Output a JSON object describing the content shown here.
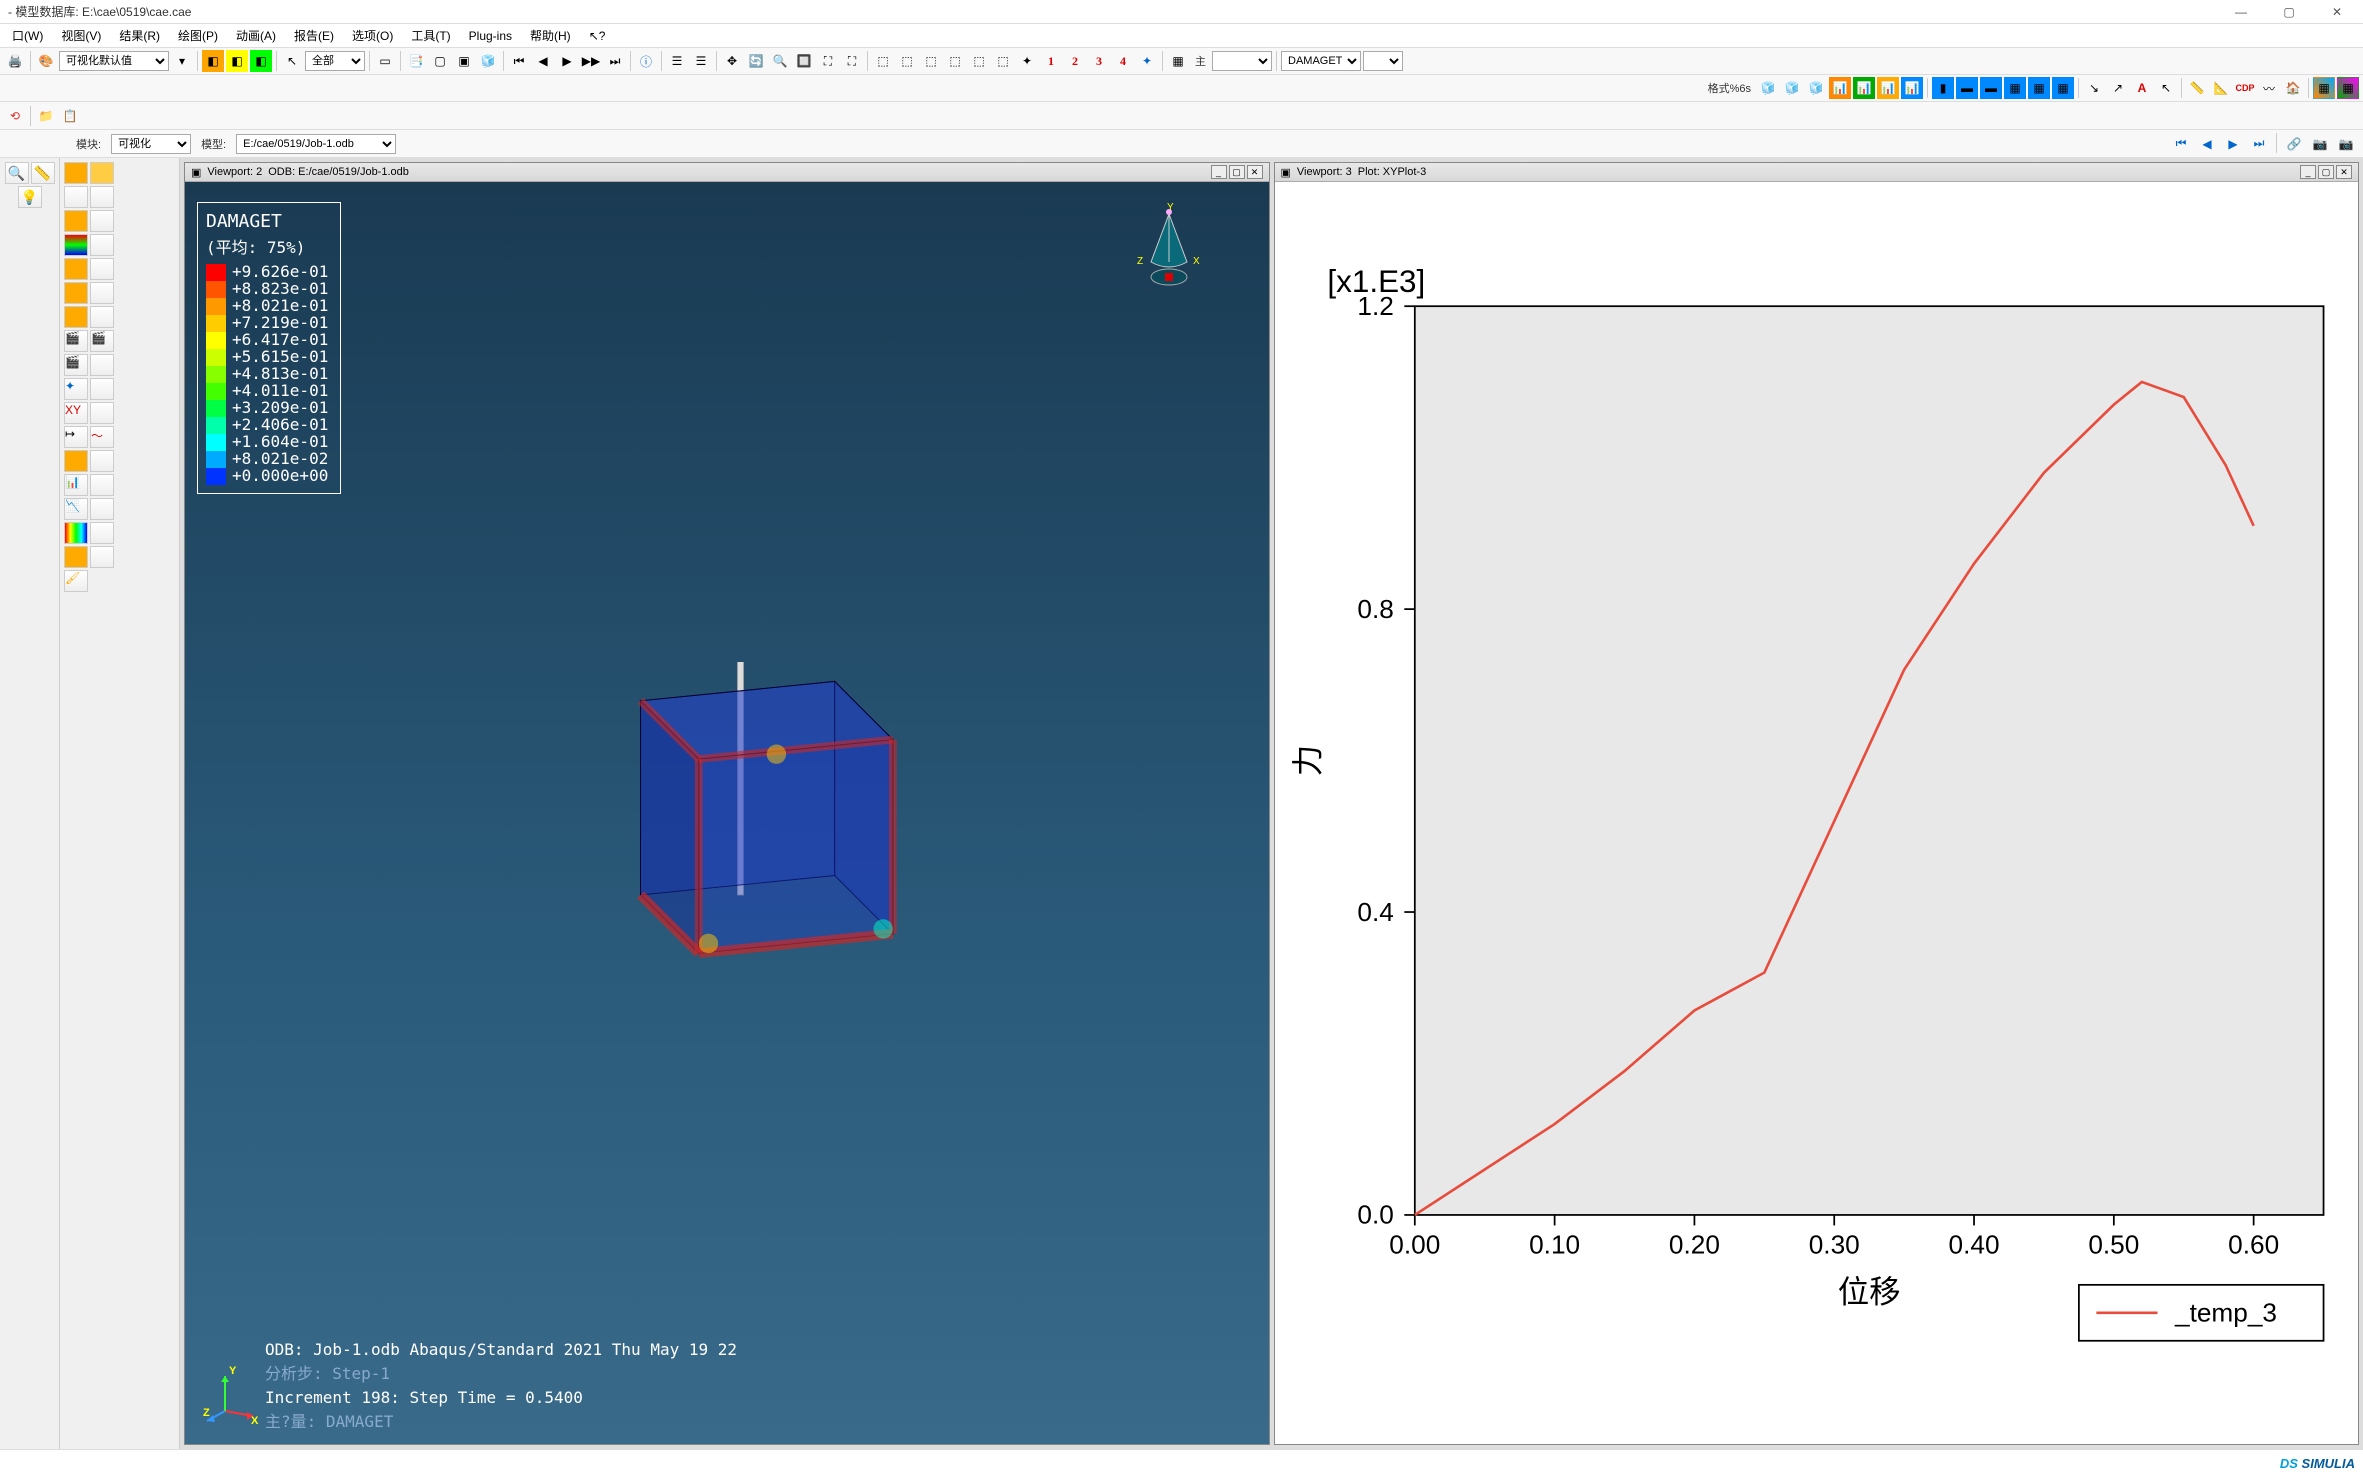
{
  "app": {
    "title_prefix": "- 模型数据库:",
    "db_path": "E:\\cae\\0519\\cae.cae"
  },
  "win_controls": {
    "min": "—",
    "max": "▢",
    "close": "✕"
  },
  "menu": {
    "items": [
      "口(W)",
      "视图(V)",
      "结果(R)",
      "绘图(P)",
      "动画(A)",
      "报告(E)",
      "选项(O)",
      "工具(T)",
      "Plug-ins",
      "帮助(H)",
      "↖?"
    ]
  },
  "toolbar1": {
    "vis_default": "可视化默认值",
    "all": "全部",
    "damaget": "DAMAGET",
    "main": "主"
  },
  "toolbar2": {
    "grid_label": "格式%6s"
  },
  "context": {
    "module_label": "模块:",
    "module_value": "可视化",
    "model_label": "模型:",
    "model_value": "E:/cae/0519/Job-1.odb"
  },
  "viewport2": {
    "header_a": "Viewport: 2",
    "header_b": "ODB: E:/cae/0519/Job-1.odb",
    "legend": {
      "title": "DAMAGET",
      "subtitle": "(平均: 75%)",
      "values": [
        "+9.626e-01",
        "+8.823e-01",
        "+8.021e-01",
        "+7.219e-01",
        "+6.417e-01",
        "+5.615e-01",
        "+4.813e-01",
        "+4.011e-01",
        "+3.209e-01",
        "+2.406e-01",
        "+1.604e-01",
        "+8.021e-02",
        "+0.000e+00"
      ],
      "colors": [
        "#ff0000",
        "#ff5500",
        "#ff9900",
        "#ffcc00",
        "#ffff00",
        "#ccff00",
        "#88ff00",
        "#44ff00",
        "#00ff44",
        "#00ffaa",
        "#00ffff",
        "#00aaff",
        "#0033ff"
      ]
    },
    "triad": {
      "x": "X",
      "y": "Y",
      "z": "Z"
    },
    "info": {
      "odb_line": "ODB: Job-1.odb    Abaqus/Standard 2021    Thu May 19 22",
      "step_line": "分析步: Step-1",
      "incr_line": "Increment    198: Step Time =   0.5400",
      "var_line": "主?量: DAMAGET",
      "axis_x": "X",
      "axis_y": "Y",
      "axis_z": "Z"
    }
  },
  "viewport3": {
    "header_a": "Viewport: 3",
    "header_b": "Plot: XYPlot-3"
  },
  "chart_data": {
    "type": "line",
    "title": "",
    "xlabel": "位移",
    "ylabel": "力",
    "y_multiplier_label": "[x1.E3]",
    "xlim": [
      0.0,
      0.65
    ],
    "ylim": [
      0.0,
      1.2
    ],
    "xticks": [
      0.0,
      0.1,
      0.2,
      0.3,
      0.4,
      0.5,
      0.6
    ],
    "yticks": [
      0.0,
      0.4,
      0.8,
      1.2
    ],
    "series": [
      {
        "name": "_temp_3",
        "color": "#e74c3c",
        "x": [
          0.0,
          0.05,
          0.1,
          0.15,
          0.2,
          0.22,
          0.25,
          0.3,
          0.35,
          0.4,
          0.45,
          0.5,
          0.52,
          0.55,
          0.58,
          0.6
        ],
        "y": [
          0.0,
          0.06,
          0.12,
          0.19,
          0.27,
          0.29,
          0.32,
          0.52,
          0.72,
          0.86,
          0.98,
          1.07,
          1.1,
          1.08,
          0.99,
          0.91
        ]
      }
    ],
    "legend_position": "bottom-right"
  },
  "footer": {
    "brand_ds": "DS",
    "brand": "SIMULIA"
  },
  "nav": {
    "first": "⏮",
    "prev": "◀",
    "next": "▶",
    "last": "⏭"
  }
}
